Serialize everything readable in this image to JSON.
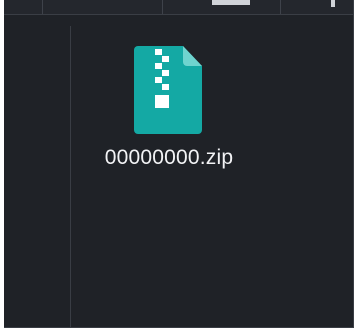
{
  "explorer": {
    "file": {
      "name": "00000000.zip",
      "icon": "zip-file-icon"
    }
  },
  "colors": {
    "background": "#1f2227",
    "file_icon": "#14a9a4",
    "file_icon_fold": "#6fd4cf",
    "text": "#f2f3f5"
  }
}
